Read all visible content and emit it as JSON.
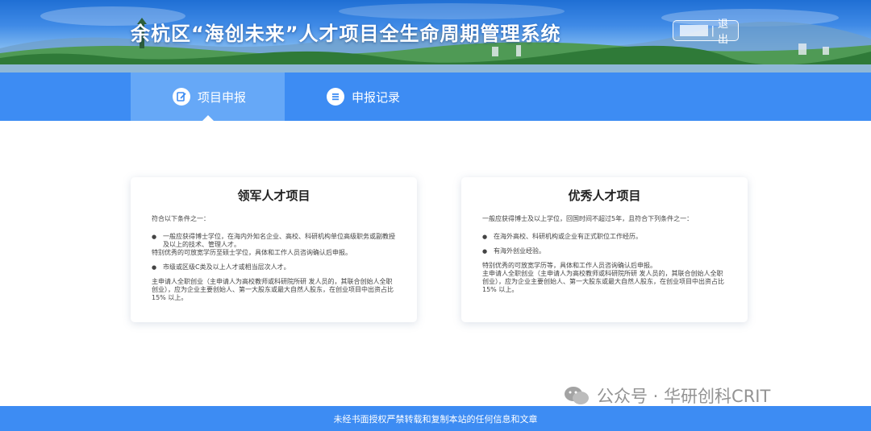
{
  "header": {
    "title": "余杭区“海创未来”人才项目全生命周期管理系统",
    "logout_label": "退出",
    "separator": "|"
  },
  "nav": {
    "tabs": [
      {
        "label": "项目申报",
        "active": true,
        "icon": "edit-doc-icon"
      },
      {
        "label": "申报记录",
        "active": false,
        "icon": "list-icon"
      }
    ]
  },
  "cards": [
    {
      "title": "领军人才项目",
      "intro": "符合以下条件之一：",
      "bullet1": "一般应获得博士学位，在海内外知名企业、高校、科研机构单位高级职务或副教授及以上的技术、管理人才。",
      "note1": "特别优秀的可放宽学历至硕士学位，具体和工作人员咨询确认后申报。",
      "bullet2": "市级或区级C类及以上人才或相当层次人才。",
      "footnote": "主申请人全职创业（主申请人为高校教师或科研院所研 发人员的，其联合创始人全职创业），应为企业主要创始人、第一大股东或最大自然人股东，在创业项目中出资占比15% 以上。"
    },
    {
      "title": "优秀人才项目",
      "intro": "一般应获得博士及以上学位，回国时间不超过5年，且符合下列条件之一：",
      "bullet1": "在海外高校、科研机构或企业有正式职位工作经历。",
      "bullet2": "有海外创业经验。",
      "note1": "特别优秀的可放宽学历等，具体和工作人员咨询确认后申报。",
      "footnote": "主申请人全职创业（主申请人为高校教师或科研院所研 发人员的，其联合创始人全职创业），应为企业主要创始人、第一大股东或最大自然人股东，在创业项目中出资占比15% 以上。"
    }
  ],
  "footer": {
    "text": "未经书面授权严禁转载和复制本站的任何信息和文章"
  },
  "watermark": {
    "text": "公众号 · 华研创科CRIT",
    "icon": "wechat-icon"
  },
  "colors": {
    "nav_bg": "#3d8cf3",
    "nav_active": "#66a8f7",
    "footer_bg": "#3d8cf3"
  }
}
